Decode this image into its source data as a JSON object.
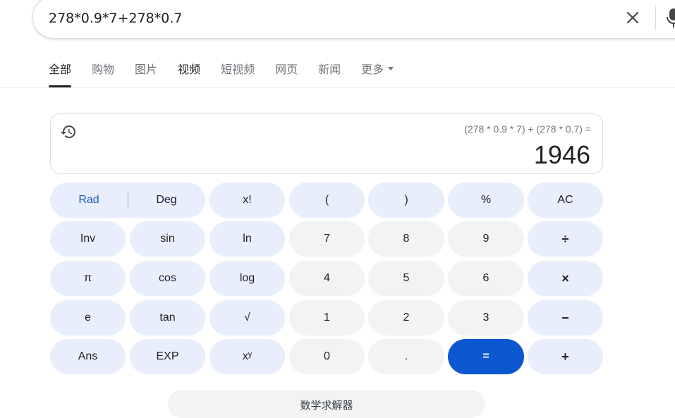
{
  "search": {
    "query": "278*0.9*7+278*0.7"
  },
  "tabs": [
    {
      "label": "全部"
    },
    {
      "label": "购物"
    },
    {
      "label": "图片"
    },
    {
      "label": "视频"
    },
    {
      "label": "短视频"
    },
    {
      "label": "网页"
    },
    {
      "label": "新闻"
    },
    {
      "label": "更多"
    }
  ],
  "calculator": {
    "expression": "(278 * 0.9 * 7) + (278 * 0.7) =",
    "result": "1946",
    "angle_mode": {
      "rad": "Rad",
      "deg": "Deg",
      "selected": "Rad"
    },
    "rows": [
      [
        "x!",
        "(",
        ")",
        "%",
        "AC"
      ],
      [
        "Inv",
        "sin",
        "ln",
        "7",
        "8",
        "9",
        "÷"
      ],
      [
        "π",
        "cos",
        "log",
        "4",
        "5",
        "6",
        "×"
      ],
      [
        "e",
        "tan",
        "√",
        "1",
        "2",
        "3",
        "−"
      ],
      [
        "Ans",
        "EXP",
        "xʸ",
        "0",
        ".",
        "=",
        "+"
      ]
    ]
  },
  "more_button": {
    "label": "数学求解器"
  },
  "colors": {
    "accent": "#0b57d0",
    "function_key": "#e8eefb",
    "number_key": "#f1f3f4"
  }
}
